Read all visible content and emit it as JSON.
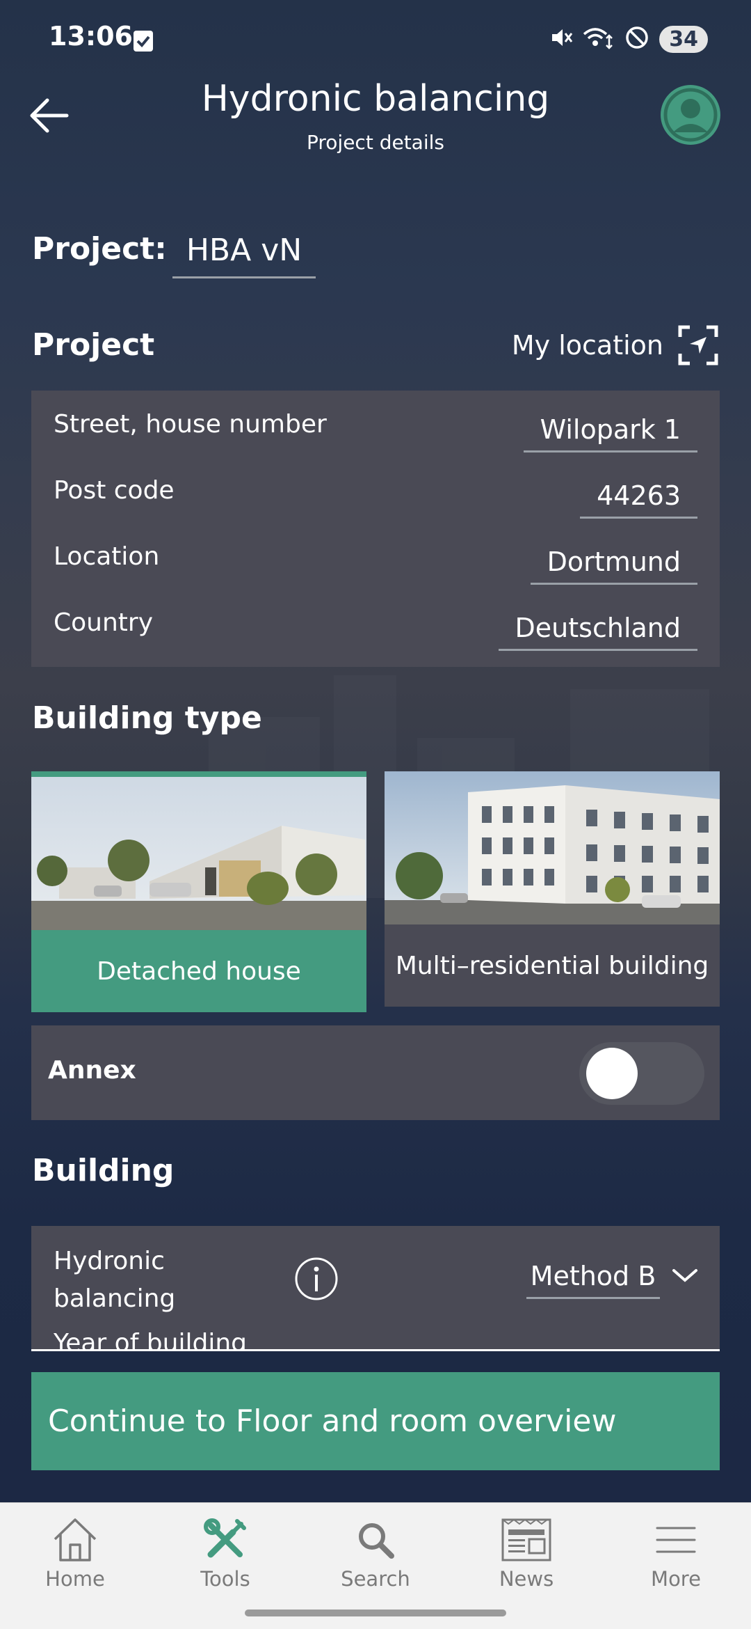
{
  "status_bar": {
    "time": "13:06",
    "battery": "34",
    "icons": [
      "check-square-icon",
      "mute-icon",
      "wifi-data-icon",
      "do-not-disturb-icon",
      "battery-icon"
    ]
  },
  "header": {
    "title": "Hydronic balancing",
    "subtitle": "Project details",
    "back_icon": "arrow-left-icon",
    "avatar_icon": "user-avatar-icon"
  },
  "project_name": {
    "label": "Project:",
    "value": "HBA vN"
  },
  "project_section": {
    "title": "Project",
    "my_location_label": "My location",
    "my_location_icon": "location-scan-icon",
    "fields": [
      {
        "label": "Street, house number",
        "value": "Wilopark 1"
      },
      {
        "label": "Post code",
        "value": "44263"
      },
      {
        "label": "Location",
        "value": "Dortmund"
      },
      {
        "label": "Country",
        "value": "Deutschland"
      }
    ]
  },
  "building_type": {
    "title": "Building type",
    "options": [
      {
        "label": "Detached house",
        "selected": true
      },
      {
        "label": "Multi–residential building",
        "selected": false
      }
    ]
  },
  "annex": {
    "label": "Annex",
    "enabled": false
  },
  "building": {
    "title": "Building",
    "hydronic_balancing_label": "Hydronic balancing",
    "method_value": "Method B",
    "next_field_label": "Year of building"
  },
  "continue_button": "Continue to Floor and room overview",
  "bottom_nav": [
    {
      "label": "Home",
      "icon": "home-icon",
      "active": false
    },
    {
      "label": "Tools",
      "icon": "tools-icon",
      "active": true
    },
    {
      "label": "Search",
      "icon": "search-icon",
      "active": false
    },
    {
      "label": "News",
      "icon": "news-icon",
      "active": false
    },
    {
      "label": "More",
      "icon": "menu-icon",
      "active": false
    }
  ],
  "colors": {
    "accent": "#449b80",
    "card": "#4a4a55",
    "nav_background": "#f2f2f2"
  }
}
